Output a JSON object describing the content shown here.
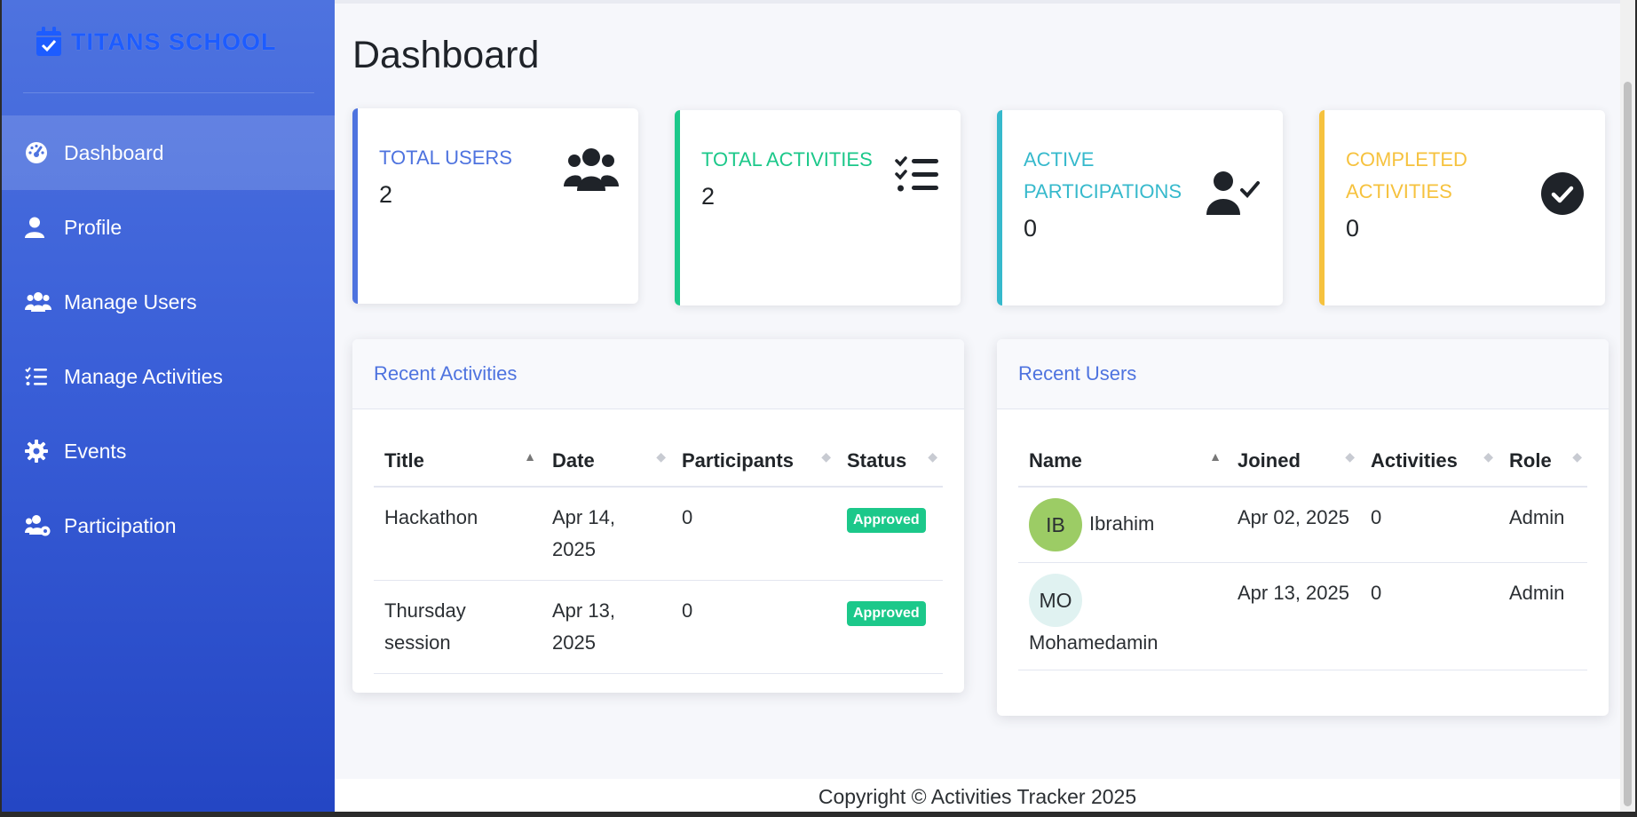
{
  "brand": {
    "name": "TITANS SCHOOL",
    "icon": "calendar-check-icon"
  },
  "sidebar": {
    "items": [
      {
        "label": "Dashboard",
        "icon": "tachometer-icon",
        "active": true
      },
      {
        "label": "Profile",
        "icon": "user-icon",
        "active": false
      },
      {
        "label": "Manage Users",
        "icon": "users-icon",
        "active": false
      },
      {
        "label": "Manage Activities",
        "icon": "list-check-icon",
        "active": false
      },
      {
        "label": "Events",
        "icon": "gear-icon",
        "active": false
      },
      {
        "label": "Participation",
        "icon": "users-gear-icon",
        "active": false
      }
    ]
  },
  "page": {
    "title": "Dashboard"
  },
  "stats": [
    {
      "label": "TOTAL USERS",
      "value": "2",
      "color": "#4e73df",
      "icon": "users-icon"
    },
    {
      "label": "TOTAL ACTIVITIES",
      "value": "2",
      "color": "#1cc88a",
      "icon": "list-check-icon"
    },
    {
      "label": "ACTIVE PARTICIPATIONS",
      "value": "0",
      "color": "#36b9cc",
      "icon": "user-check-icon"
    },
    {
      "label": "COMPLETED ACTIVITIES",
      "value": "0",
      "color": "#f6c23e",
      "icon": "check-circle-icon"
    }
  ],
  "recent_activities": {
    "title": "Recent Activities",
    "columns": [
      "Title",
      "Date",
      "Participants",
      "Status"
    ],
    "rows": [
      {
        "title": "Hackathon",
        "date": "Apr 14, 2025",
        "participants": "0",
        "status": "Approved"
      },
      {
        "title": "Thursday session",
        "date": "Apr 13, 2025",
        "participants": "0",
        "status": "Approved"
      }
    ]
  },
  "recent_users": {
    "title": "Recent Users",
    "columns": [
      "Name",
      "Joined",
      "Activities",
      "Role"
    ],
    "rows": [
      {
        "initials": "IB",
        "name": "Ibrahim",
        "joined": "Apr 02, 2025",
        "activities": "0",
        "role": "Admin"
      },
      {
        "initials": "MO",
        "name": "Mohamedamin",
        "joined": "Apr 13, 2025",
        "activities": "0",
        "role": "Admin"
      }
    ]
  },
  "footer": {
    "text": "Copyright © Activities Tracker 2025"
  }
}
